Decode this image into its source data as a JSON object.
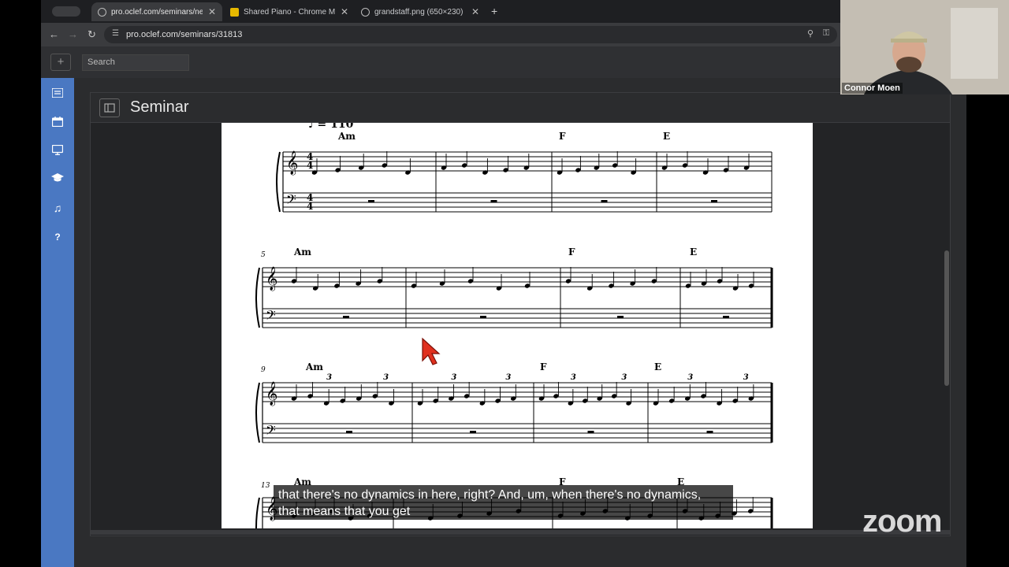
{
  "browser": {
    "tabs": [
      {
        "title": "pro.oclef.com/seminars/new?",
        "close": "✕",
        "active": true
      },
      {
        "title": "Shared Piano - Chrome Musi",
        "close": "✕",
        "active": false
      },
      {
        "title": "grandstaff.png (650×230)",
        "close": "✕",
        "active": false
      }
    ],
    "new_tab": "+",
    "url": "pro.oclef.com/seminars/31813"
  },
  "app": {
    "plus_label": "+",
    "search_placeholder": "Search",
    "panel_title": "Seminar",
    "sidebar_items": [
      {
        "icon": "list-icon"
      },
      {
        "icon": "calendar-icon"
      },
      {
        "icon": "monitor-icon"
      },
      {
        "icon": "graduation-cap-icon"
      },
      {
        "icon": "music-note-icon"
      },
      {
        "icon": "question-icon",
        "label": "?"
      }
    ]
  },
  "sheet": {
    "tempo": "♩ = 110",
    "systems": [
      {
        "measure_number": "",
        "chords": [
          "Am",
          "F",
          "E"
        ],
        "triplets": false
      },
      {
        "measure_number": "5",
        "chords": [
          "Am",
          "F",
          "E"
        ],
        "triplets": false
      },
      {
        "measure_number": "9",
        "chords": [
          "Am",
          "F",
          "E"
        ],
        "triplets": true,
        "tuplet_label": "3"
      },
      {
        "measure_number": "13",
        "chords": [
          "Am",
          "F",
          "E"
        ],
        "triplets": false
      }
    ]
  },
  "video": {
    "participant_name": "Connor Moen",
    "caption_line1": "that there's no dynamics in here, right? And, um, when there's no dynamics,",
    "caption_line2": "that means that you get",
    "logo": "zoom"
  },
  "colors": {
    "sidebar": "#4a78c2",
    "cursor": "#e0301e"
  }
}
